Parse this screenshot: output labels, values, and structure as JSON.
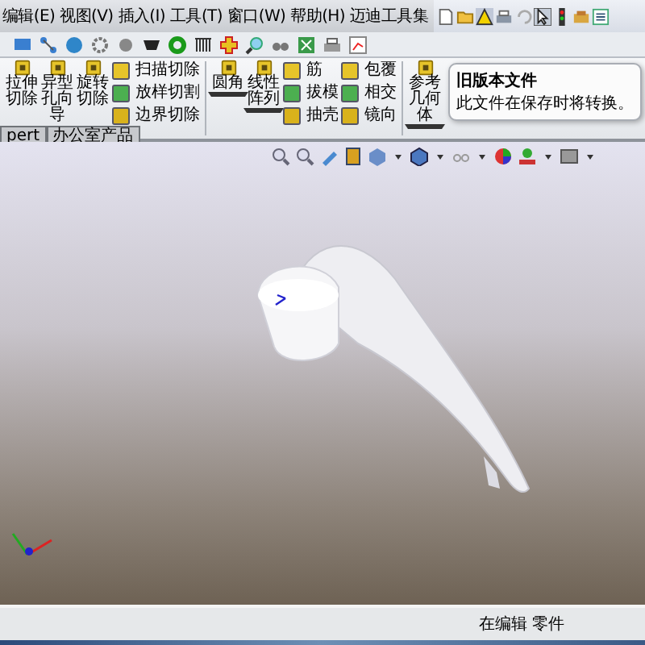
{
  "menu": [
    "编辑(E)",
    "视图(V)",
    "插入(I)",
    "工具(T)",
    "窗口(W)",
    "帮助(H)",
    "迈迪工具集"
  ],
  "ribbon": [
    {
      "kind": "big",
      "label": "拉伸切除",
      "dropdown": false
    },
    {
      "kind": "big",
      "label": "异型孔向导",
      "dropdown": false
    },
    {
      "kind": "big",
      "label": "旋转切除",
      "dropdown": false
    },
    {
      "kind": "stack",
      "items": [
        "扫描切除",
        "放样切割",
        "边界切除"
      ]
    },
    {
      "kind": "sep"
    },
    {
      "kind": "big",
      "label": "圆角",
      "dropdown": true
    },
    {
      "kind": "big",
      "label": "线性阵列",
      "dropdown": true
    },
    {
      "kind": "stack",
      "items": [
        "筋",
        "拔模",
        "抽壳"
      ]
    },
    {
      "kind": "stack",
      "items": [
        "包覆",
        "相交",
        "镜向"
      ]
    },
    {
      "kind": "sep"
    },
    {
      "kind": "big",
      "label": "参考几何体",
      "dropdown": true
    }
  ],
  "tooltip": {
    "title": "旧版本文件",
    "text": "此文件在保存时将转换。"
  },
  "tabs": [
    {
      "label": "pert",
      "selected": false
    },
    {
      "label": "办公室产品",
      "selected": false
    }
  ],
  "status_bar": {
    "text": "在编辑 零件"
  }
}
